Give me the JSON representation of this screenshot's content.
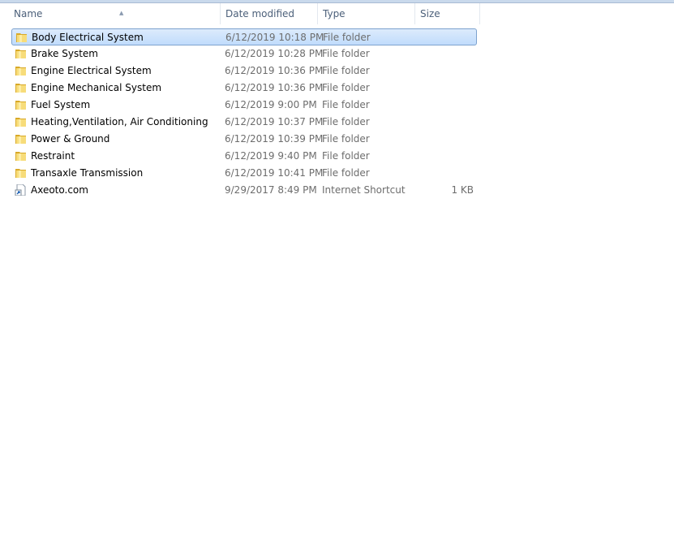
{
  "columns": {
    "name": "Name",
    "date": "Date modified",
    "type": "Type",
    "size": "Size"
  },
  "files": [
    {
      "name": "Body Electrical System",
      "date": "6/12/2019 10:18 PM",
      "type": "File folder",
      "size": "",
      "icon": "folder",
      "selected": true
    },
    {
      "name": "Brake System",
      "date": "6/12/2019 10:28 PM",
      "type": "File folder",
      "size": "",
      "icon": "folder"
    },
    {
      "name": "Engine Electrical System",
      "date": "6/12/2019 10:36 PM",
      "type": "File folder",
      "size": "",
      "icon": "folder"
    },
    {
      "name": "Engine Mechanical System",
      "date": "6/12/2019 10:36 PM",
      "type": "File folder",
      "size": "",
      "icon": "folder"
    },
    {
      "name": "Fuel System",
      "date": "6/12/2019 9:00 PM",
      "type": "File folder",
      "size": "",
      "icon": "folder"
    },
    {
      "name": "Heating,Ventilation, Air Conditioning",
      "date": "6/12/2019 10:37 PM",
      "type": "File folder",
      "size": "",
      "icon": "folder"
    },
    {
      "name": "Power & Ground",
      "date": "6/12/2019 10:39 PM",
      "type": "File folder",
      "size": "",
      "icon": "folder"
    },
    {
      "name": "Restraint",
      "date": "6/12/2019 9:40 PM",
      "type": "File folder",
      "size": "",
      "icon": "folder"
    },
    {
      "name": "Transaxle Transmission",
      "date": "6/12/2019 10:41 PM",
      "type": "File folder",
      "size": "",
      "icon": "folder"
    },
    {
      "name": "Axeoto.com",
      "date": "9/29/2017 8:49 PM",
      "type": "Internet Shortcut",
      "size": "1 KB",
      "icon": "internet-shortcut"
    }
  ]
}
